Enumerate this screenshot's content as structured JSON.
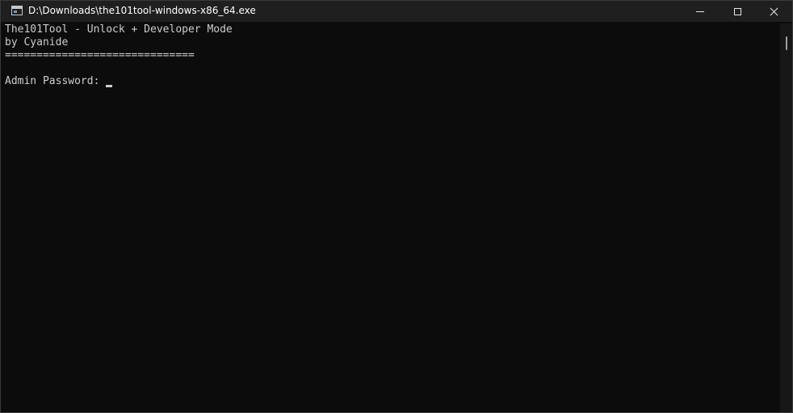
{
  "window": {
    "title": "D:\\Downloads\\the101tool-windows-x86_64.exe"
  },
  "console": {
    "lines": [
      "The101Tool - Unlock + Developer Mode",
      "by Cyanide",
      "==============================",
      ""
    ],
    "prompt": "Admin Password:"
  },
  "icons": {
    "app": "console-window-icon",
    "minimize": "minimize-icon",
    "maximize": "maximize-icon",
    "close": "close-icon"
  },
  "colors": {
    "background": "#0c0c0c",
    "titlebar": "#1f1f1f",
    "text": "#cccccc"
  }
}
